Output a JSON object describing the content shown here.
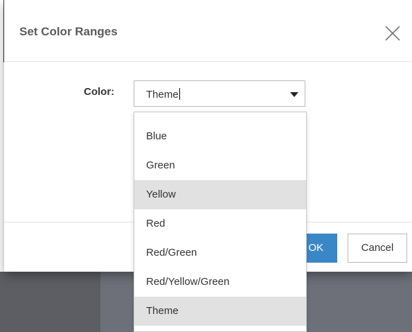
{
  "dialog": {
    "title": "Set Color Ranges",
    "close_icon": "close-icon"
  },
  "form": {
    "color_label": "Color:",
    "color_value": "Theme"
  },
  "dropdown": {
    "options": [
      {
        "label": "Blue",
        "highlighted": false
      },
      {
        "label": "Green",
        "highlighted": false
      },
      {
        "label": "Yellow",
        "highlighted": true
      },
      {
        "label": "Red",
        "highlighted": false
      },
      {
        "label": "Red/Green",
        "highlighted": false
      },
      {
        "label": "Red/Yellow/Green",
        "highlighted": false
      },
      {
        "label": "Theme",
        "highlighted": true
      }
    ]
  },
  "footer": {
    "ok_label": "OK",
    "cancel_label": "Cancel"
  },
  "colors": {
    "primary_button": "#3a87c8",
    "highlight": "#e1e1e1",
    "title_text": "#5b5b5b"
  }
}
